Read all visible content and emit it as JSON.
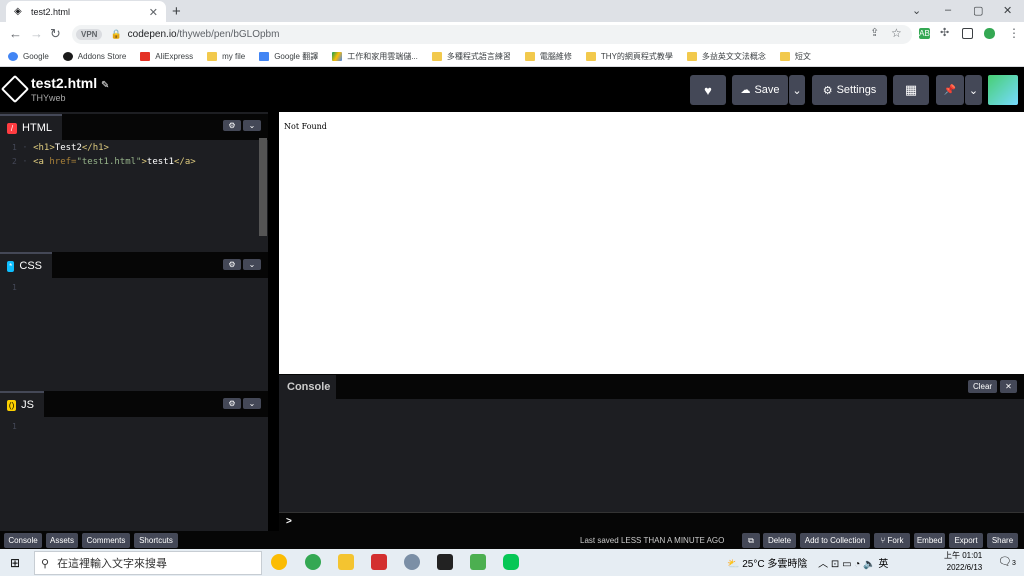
{
  "browser": {
    "tab_title": "test2.html",
    "new_tab": "+",
    "url_domain": "codepen.io",
    "url_path": "/thyweb/pen/bGLOpbm",
    "vpn_badge": "VPN",
    "win_min": "⌄",
    "win_minimize": "–",
    "win_restore": "▢",
    "win_close": "✕",
    "extensions": [
      "AB",
      "",
      "",
      ""
    ]
  },
  "bookmarks": [
    {
      "label": "Google",
      "icon": "google-icon"
    },
    {
      "label": "Addons Store",
      "icon": "addons-icon"
    },
    {
      "label": "AliExpress",
      "icon": "aliexpress-icon"
    },
    {
      "label": "my file",
      "icon": "folder-icon"
    },
    {
      "label": "Google 翻譯",
      "icon": "translate-icon"
    },
    {
      "label": "工作和家用雲端儲...",
      "icon": "drive-icon"
    },
    {
      "label": "多種程式語言練習",
      "icon": "folder-icon"
    },
    {
      "label": "電腦維修",
      "icon": "folder-icon"
    },
    {
      "label": "THY的網頁程式教學",
      "icon": "folder-icon"
    },
    {
      "label": "多益英文文法概念",
      "icon": "folder-icon"
    },
    {
      "label": "短文",
      "icon": "folder-icon"
    }
  ],
  "codepen": {
    "pen_title": "test2.html",
    "edit_icon": "✎",
    "author": "THYweb",
    "heart": "♥",
    "save_label": "Save",
    "settings_label": "Settings",
    "layout_icon": "▦",
    "pin_icon": "📌",
    "caret": "⌄"
  },
  "editors": {
    "html_label": "HTML",
    "css_label": "CSS",
    "js_label": "JS",
    "html_badge": "/",
    "css_badge": "*",
    "js_badge": "()",
    "gear": "⚙",
    "collapse": "⌄",
    "html_lines": [
      {
        "num": "1",
        "open": "<h1>",
        "text": "Test2",
        "close": "</h1>"
      },
      {
        "num": "2",
        "open": "<a ",
        "attr": "href=",
        "str": "\"test1.html\"",
        "gt": ">",
        "text": "test1",
        "close": "</a>"
      }
    ],
    "css_line": "1",
    "js_line": "1"
  },
  "preview": {
    "text": "Not Found"
  },
  "console": {
    "label": "Console",
    "clear": "Clear",
    "close": "✕",
    "prompt": ">"
  },
  "footer": {
    "console": "Console",
    "assets": "Assets",
    "comments": "Comments",
    "shortcuts": "Shortcuts",
    "saved_prefix": "Last saved",
    "saved_time": "LESS THAN A MINUTE AGO",
    "open_icon": "⧉",
    "delete": "Delete",
    "add_collection": "Add to Collection",
    "fork": "⑂ Fork",
    "embed": "Embed",
    "export": "Export",
    "share": "Share"
  },
  "taskbar": {
    "search_placeholder": "在這裡輸入文字來搜尋",
    "weather": "25°C  多雲時陰",
    "tray": "︿  ⊡  ▭  ◔  🔈  英",
    "time": "上午 01:01",
    "date": "2022/6/13",
    "notif": "3"
  }
}
